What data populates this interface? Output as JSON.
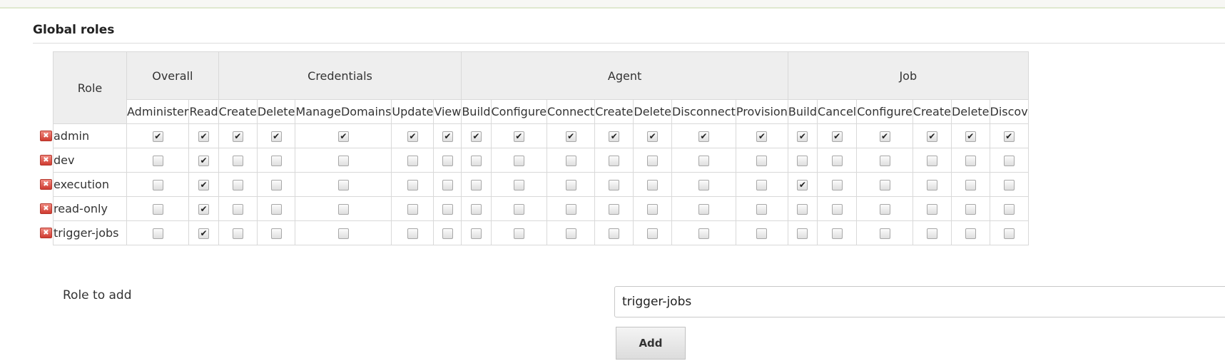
{
  "section_title": "Global roles",
  "table": {
    "role_header": "Role",
    "groups": [
      {
        "label": "Overall",
        "span": 2
      },
      {
        "label": "Credentials",
        "span": 5
      },
      {
        "label": "Agent",
        "span": 7
      },
      {
        "label": "Job",
        "span": 6
      }
    ],
    "permissions": [
      "Administer",
      "Read",
      "Create",
      "Delete",
      "ManageDomains",
      "Update",
      "View",
      "Build",
      "Configure",
      "Connect",
      "Create",
      "Delete",
      "Disconnect",
      "Provision",
      "Build",
      "Cancel",
      "Configure",
      "Create",
      "Delete",
      "Discov"
    ],
    "rows": [
      {
        "role": "admin",
        "checked": [
          1,
          1,
          1,
          1,
          1,
          1,
          1,
          1,
          1,
          1,
          1,
          1,
          1,
          1,
          1,
          1,
          1,
          1,
          1,
          1
        ]
      },
      {
        "role": "dev",
        "checked": [
          0,
          1,
          0,
          0,
          0,
          0,
          0,
          0,
          0,
          0,
          0,
          0,
          0,
          0,
          0,
          0,
          0,
          0,
          0,
          0
        ]
      },
      {
        "role": "execution",
        "checked": [
          0,
          1,
          0,
          0,
          0,
          0,
          0,
          0,
          0,
          0,
          0,
          0,
          0,
          0,
          1,
          0,
          0,
          0,
          0,
          0
        ]
      },
      {
        "role": "read-only",
        "checked": [
          0,
          1,
          0,
          0,
          0,
          0,
          0,
          0,
          0,
          0,
          0,
          0,
          0,
          0,
          0,
          0,
          0,
          0,
          0,
          0
        ]
      },
      {
        "role": "trigger-jobs",
        "checked": [
          0,
          1,
          0,
          0,
          0,
          0,
          0,
          0,
          0,
          0,
          0,
          0,
          0,
          0,
          0,
          0,
          0,
          0,
          0,
          0
        ]
      }
    ],
    "delete_icon": "delete-icon"
  },
  "add_role": {
    "label": "Role to add",
    "value": "trigger-jobs",
    "button_label": "Add"
  },
  "colors": {
    "header_bg": "#eeeeee",
    "delete_icon": "#d9453a",
    "border": "#d9d9d9"
  }
}
